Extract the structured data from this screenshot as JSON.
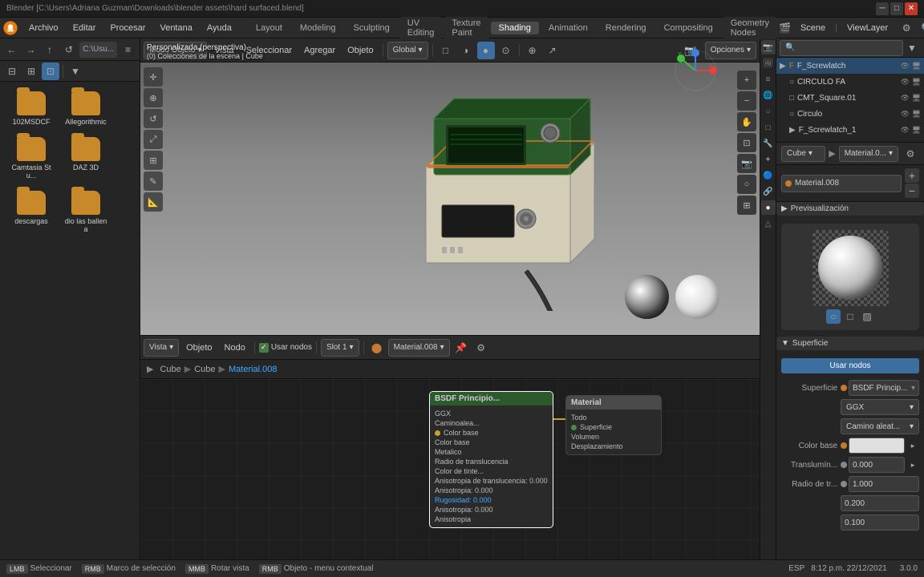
{
  "titlebar": {
    "title": "Blender [C:\\Users\\Adriana Guzman\\Downloads\\blender assets\\hard surfaced.blend]",
    "minimize": "─",
    "maximize": "□",
    "close": "✕"
  },
  "topmenu": {
    "items": [
      "Archivo",
      "Editar",
      "Procesar",
      "Ventana",
      "Ayuda"
    ],
    "workspaces": [
      "Layout",
      "Modeling",
      "Sculpting",
      "UV Editing",
      "Texture Paint",
      "Shading",
      "Animation",
      "Rendering",
      "Compositing",
      "Geometry Nodes"
    ],
    "active_workspace": "Shading",
    "scene": "Scene",
    "viewlayer": "ViewLayer"
  },
  "left_panel": {
    "path": "C:\\Usu...",
    "folders": [
      "102MSDCF",
      "Allegorithmic",
      "Camtasia Stu...",
      "DAZ 3D",
      "descargas",
      "dio las ballena"
    ]
  },
  "viewport": {
    "mode": "Modo Objeto",
    "view_label": "Vista",
    "select_label": "Seleccionar",
    "add_label": "Agregar",
    "object_label": "Objeto",
    "shading_label": "Global",
    "perspective": "Personalizada (perspectiva)",
    "collection_info": "(0) Colecciones de la escena | Cube"
  },
  "node_editor": {
    "view_label": "Vista",
    "object_label": "Objeto",
    "node_label": "Nodo",
    "use_nodes_label": "Usar nodos",
    "slot_label": "Slot 1",
    "material_label": "Material.008",
    "breadcrumb": [
      "Cube",
      "Cube",
      "Material.008"
    ],
    "nodes": [
      {
        "id": "bsdf",
        "title": "BSDF Principio...",
        "type": "green",
        "inputs": [
          "GGX",
          "Caminoalea...",
          "Color base",
          "Metalico",
          "Radio de translucencia",
          "Color de tinte...",
          "Anisotropia de translucencia: 0.000",
          "Anisotropia: 0.000",
          "Rugosidad: 0.000",
          "Anisotropia: 0.000",
          "Anisotropia"
        ]
      },
      {
        "id": "material",
        "title": "Material",
        "type": "gray",
        "outputs": [
          "Todo",
          "Superficie",
          "Volumen",
          "Desplazamiento"
        ]
      }
    ]
  },
  "outliner": {
    "items": [
      {
        "label": "F_Screwlatch",
        "icon": "▶",
        "indent": 0
      },
      {
        "label": "CIRCULO FA",
        "icon": "○",
        "indent": 1
      },
      {
        "label": "CMT_Square.01",
        "icon": "□",
        "indent": 1
      },
      {
        "label": "Circulo",
        "icon": "○",
        "indent": 1
      },
      {
        "label": "F_Screwlatch_1",
        "icon": "▶",
        "indent": 1
      },
      {
        "label": "F_Screwlatch_1",
        "icon": "▶",
        "indent": 1
      }
    ]
  },
  "properties": {
    "active_material": "Material.008",
    "material_name": "Material.0...",
    "preview_section": "Previsualización",
    "surface_section": "Superficie",
    "use_nodes_btn": "Usar nodos",
    "surface_label": "Superficie",
    "bsdf_value": "BSDF Princip...",
    "ggx_label": "GGX",
    "path_label": "Camino aleat...",
    "color_base_label": "Color base",
    "translum_label": "Translumín...",
    "translum_value": "0.000",
    "radio_label": "Radio de tr...",
    "radio_values": [
      "1.000",
      "0.200",
      "0.100"
    ],
    "object_name": "Cube",
    "version": "3.0.0"
  },
  "statusbar": {
    "select_label": "Seleccionar",
    "marco_label": "Marco de selección",
    "rotar_label": "Rotar vista",
    "objeto_label": "Objeto - menu contextual",
    "datetime": "8:12 p.m. 22/12/2021",
    "keyboard_layout": "ESP"
  }
}
